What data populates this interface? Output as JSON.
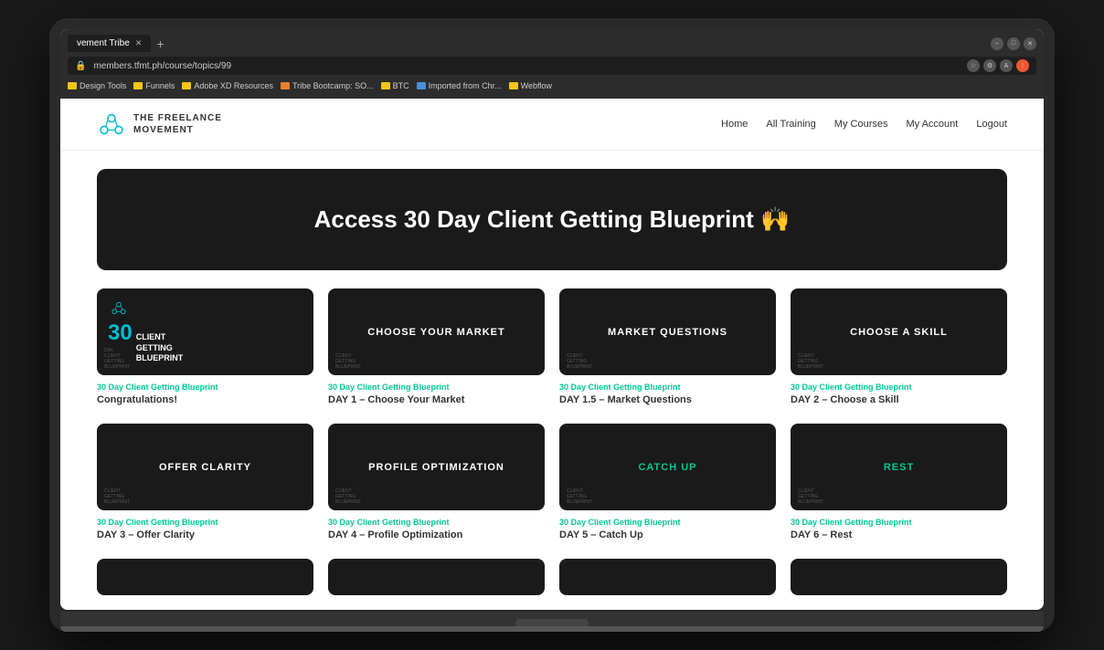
{
  "browser": {
    "tab_label": "vement Tribe",
    "url": "members.tfmt.ph/course/topics/99",
    "bookmarks": [
      {
        "label": "Design Tools",
        "color": "yellow"
      },
      {
        "label": "Funnels",
        "color": "yellow"
      },
      {
        "label": "Adobe XD Resources",
        "color": "yellow"
      },
      {
        "label": "Tribe Bootcamp: SO...",
        "color": "orange"
      },
      {
        "label": "BTC",
        "color": "yellow"
      },
      {
        "label": "Imported from Chr...",
        "color": "blue"
      },
      {
        "label": "Webflow",
        "color": "yellow"
      }
    ]
  },
  "nav": {
    "logo_line1": "THE FREELANCE",
    "logo_line2": "MOVEMENT",
    "links": [
      "Home",
      "All Training",
      "My Courses",
      "My Account",
      "Logout"
    ]
  },
  "hero": {
    "title": "Access 30 Day Client Getting Blueprint 🙌"
  },
  "courses": [
    {
      "label": "30 Day Client Getting Blueprint",
      "title": "Congratulations!",
      "thumb_type": "logo",
      "thumb_text": ""
    },
    {
      "label": "30 Day Client Getting Blueprint",
      "title": "DAY 1 – Choose Your Market",
      "thumb_type": "text",
      "thumb_text": "CHOOSE YOUR MARKET"
    },
    {
      "label": "30 Day Client Getting Blueprint",
      "title": "DAY 1.5 – Market Questions",
      "thumb_type": "text",
      "thumb_text": "MARKET QUESTIONS"
    },
    {
      "label": "30 Day Client Getting Blueprint",
      "title": "DAY 2 – Choose a Skill",
      "thumb_type": "text",
      "thumb_text": "CHOOSE A SKILL"
    },
    {
      "label": "30 Day Client Getting Blueprint",
      "title": "DAY 3 – Offer Clarity",
      "thumb_type": "text",
      "thumb_text": "OFFER CLARITY"
    },
    {
      "label": "30 Day Client Getting Blueprint",
      "title": "DAY 4 – Profile Optimization",
      "thumb_type": "text",
      "thumb_text": "PROFILE OPTIMIZATION"
    },
    {
      "label": "30 Day Client Getting Blueprint",
      "title": "DAY 5 – Catch Up",
      "thumb_type": "text_green",
      "thumb_text": "CATCH UP"
    },
    {
      "label": "30 Day Client Getting Blueprint",
      "title": "DAY 6 – Rest",
      "thumb_type": "text_green",
      "thumb_text": "REST"
    }
  ],
  "colors": {
    "accent": "#00c896",
    "dark": "#1a1a1a",
    "white": "#ffffff"
  }
}
